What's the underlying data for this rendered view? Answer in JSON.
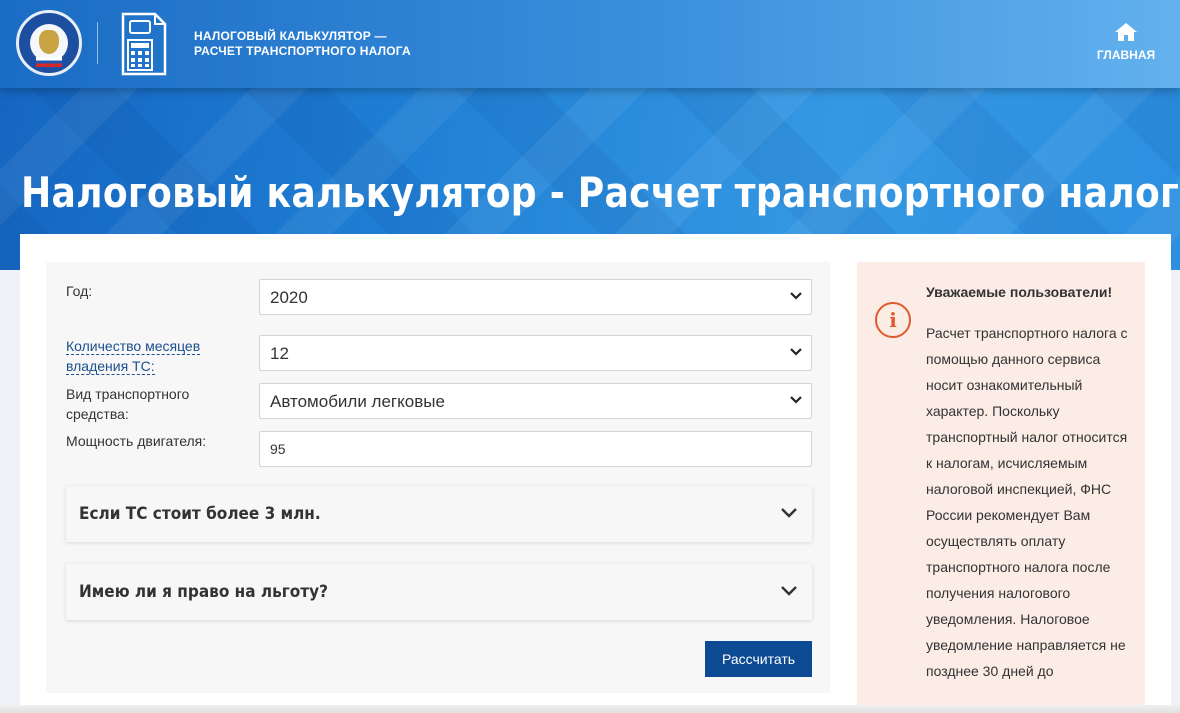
{
  "header": {
    "brand_title_line1": "НАЛОГОВЫЙ КАЛЬКУЛЯТОР —",
    "brand_title_line2": "РАСЧЕТ ТРАНСПОРТНОГО НАЛОГА",
    "home_label": "ГЛАВНАЯ",
    "emblem_text": "ФЕДЕРАЛЬНАЯ НАЛОГОВАЯ СЛУЖБА"
  },
  "page_title": "Налоговый калькулятор - Расчет транспортного налога",
  "form": {
    "year": {
      "label": "Год:",
      "value": "2020"
    },
    "months": {
      "label": "Количество месяцев владения ТС:",
      "value": "12"
    },
    "vehicle_type": {
      "label": "Вид транспортного средства:",
      "value": "Автомобили легковые"
    },
    "engine_power": {
      "label": "Мощность двигателя:",
      "value": "95"
    },
    "accordion_expensive": "Если ТС стоит более 3 млн.",
    "accordion_benefit": "Имею ли я право на льготу?",
    "submit_label": "Рассчитать"
  },
  "notice": {
    "icon": "i",
    "title": "Уважаемые пользователи!",
    "body": "Расчет транспортного налога с помощью данного сервиса носит ознакомительный характер. Поскольку транспортный налог относится к налогам, исчисляемым налоговой инспекцией, ФНС России рекомендует Вам осуществлять оплату транспортного налога после получения налогового уведомления. Налоговое уведомление направляется не позднее 30 дней до"
  },
  "colors": {
    "header_blue": "#1f7fd4",
    "button_blue": "#0c4a93",
    "notice_bg": "#fbece6",
    "notice_accent": "#e05a2a",
    "link_blue": "#1b4f8e"
  }
}
